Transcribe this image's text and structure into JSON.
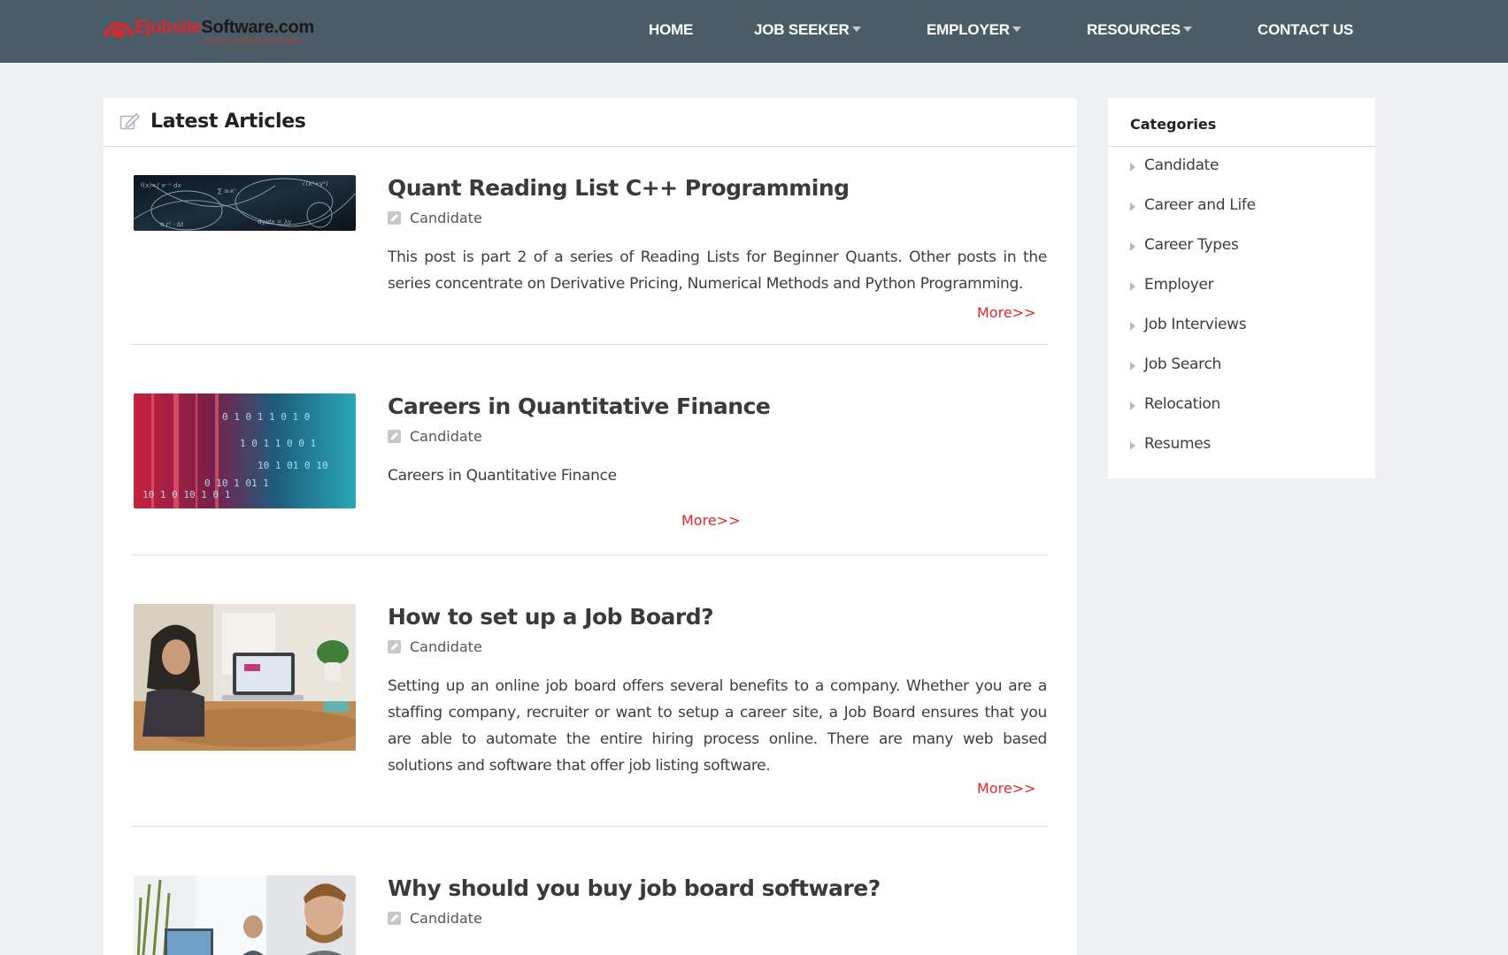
{
  "brand": {
    "name_red": "Ejobsite",
    "name_dark": "Software.com",
    "tagline": "Custom Job Board Software",
    "accent_color": "#e0262b",
    "header_bg": "#4a5c68"
  },
  "nav": {
    "items": [
      {
        "label": "HOME",
        "dropdown": false
      },
      {
        "label": "JOB SEEKER",
        "dropdown": true
      },
      {
        "label": "EMPLOYER",
        "dropdown": true
      },
      {
        "label": "RESOURCES",
        "dropdown": true
      },
      {
        "label": "CONTACT US",
        "dropdown": false
      }
    ]
  },
  "main": {
    "title": "Latest Articles",
    "more_label": "More>>",
    "articles": [
      {
        "title": "Quant Reading List C++ Programming",
        "category": "Candidate",
        "description": "This post is part 2 of a series of Reading Lists for Beginner Quants. Other posts in the series concentrate on Derivative Pricing, Numerical Methods and Python Programming.",
        "image": "math-formulas-dark"
      },
      {
        "title": "Careers in Quantitative Finance",
        "category": "Candidate",
        "description": "Careers in Quantitative Finance",
        "image": "binary-code-red-blue"
      },
      {
        "title": "How to set up a Job Board?",
        "category": "Candidate",
        "description": "Setting up an online job board offers several benefits to a company. Whether you are a staffing company, recruiter or want to setup a career site, a Job Board ensures that you are able to automate the entire hiring process online. There are many web based solutions and software that offer job listing software.",
        "image": "woman-at-laptop"
      },
      {
        "title": "Why should you buy job board software?",
        "category": "Candidate",
        "description": "",
        "image": "men-in-office"
      }
    ]
  },
  "sidebar": {
    "title": "Categories",
    "items": [
      {
        "label": "Candidate"
      },
      {
        "label": "Career and Life"
      },
      {
        "label": "Career Types"
      },
      {
        "label": "Employer"
      },
      {
        "label": "Job Interviews"
      },
      {
        "label": "Job Search"
      },
      {
        "label": "Relocation"
      },
      {
        "label": "Resumes"
      }
    ]
  }
}
